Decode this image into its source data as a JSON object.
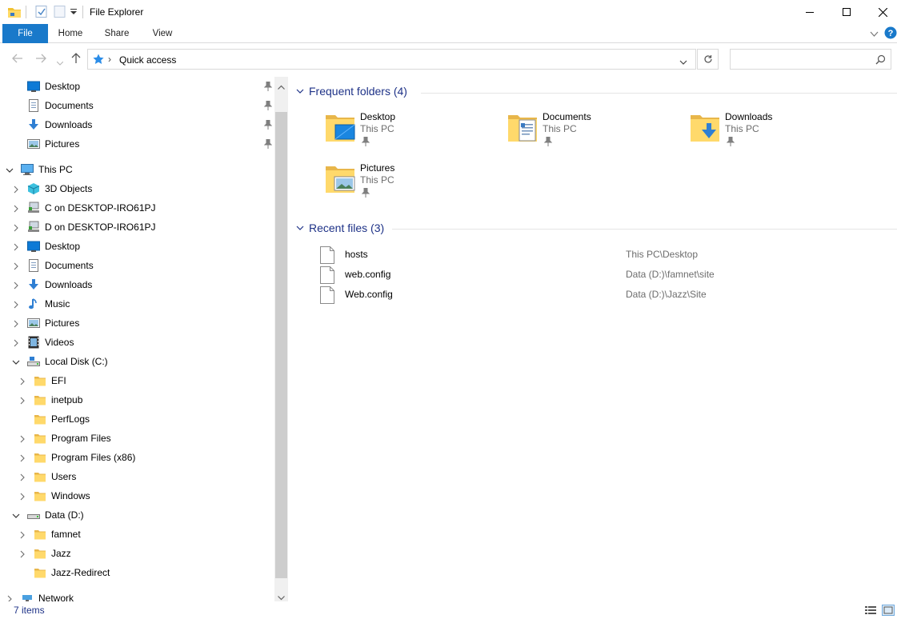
{
  "window": {
    "title": "File Explorer",
    "icons": [
      "folder-icon",
      "properties-icon",
      "new-folder-icon",
      "customize-dropdown-icon"
    ]
  },
  "ribbon": {
    "tabs": [
      "File",
      "Home",
      "Share",
      "View"
    ],
    "accent": "#1979ca"
  },
  "address": {
    "location": "Quick access",
    "icon": "quick-access-star-icon"
  },
  "search": {
    "placeholder": ""
  },
  "nav": {
    "quick_access": [
      {
        "label": "Desktop",
        "icon": "desktop-icon"
      },
      {
        "label": "Documents",
        "icon": "documents-icon"
      },
      {
        "label": "Downloads",
        "icon": "downloads-icon"
      },
      {
        "label": "Pictures",
        "icon": "pictures-icon"
      }
    ],
    "this_pc": {
      "label": "This PC"
    },
    "this_pc_children": [
      {
        "label": "3D Objects"
      },
      {
        "label": "C on DESKTOP-IRO61PJ"
      },
      {
        "label": "D on DESKTOP-IRO61PJ"
      },
      {
        "label": "Desktop"
      },
      {
        "label": "Documents"
      },
      {
        "label": "Downloads"
      },
      {
        "label": "Music"
      },
      {
        "label": "Pictures"
      },
      {
        "label": "Videos"
      }
    ],
    "local_disk": {
      "label": "Local Disk (C:)"
    },
    "local_disk_children": [
      {
        "label": "EFI"
      },
      {
        "label": "inetpub"
      },
      {
        "label": "PerfLogs"
      },
      {
        "label": "Program Files"
      },
      {
        "label": "Program Files (x86)"
      },
      {
        "label": "Users"
      },
      {
        "label": "Windows"
      }
    ],
    "data_drive": {
      "label": "Data (D:)"
    },
    "data_drive_children": [
      {
        "label": "famnet"
      },
      {
        "label": "Jazz"
      },
      {
        "label": "Jazz-Redirect"
      }
    ],
    "network": {
      "label": "Network"
    }
  },
  "content": {
    "frequent_header": "Frequent folders (4)",
    "frequent": [
      {
        "name": "Desktop",
        "location": "This PC"
      },
      {
        "name": "Documents",
        "location": "This PC"
      },
      {
        "name": "Downloads",
        "location": "This PC"
      },
      {
        "name": "Pictures",
        "location": "This PC"
      }
    ],
    "recent_header": "Recent files (3)",
    "recent": [
      {
        "name": "hosts",
        "location": "This PC\\Desktop"
      },
      {
        "name": "web.config",
        "location": "Data (D:)\\famnet\\site"
      },
      {
        "name": "Web.config",
        "location": "Data (D:)\\Jazz\\Site"
      }
    ]
  },
  "status": {
    "count": "7 items"
  }
}
